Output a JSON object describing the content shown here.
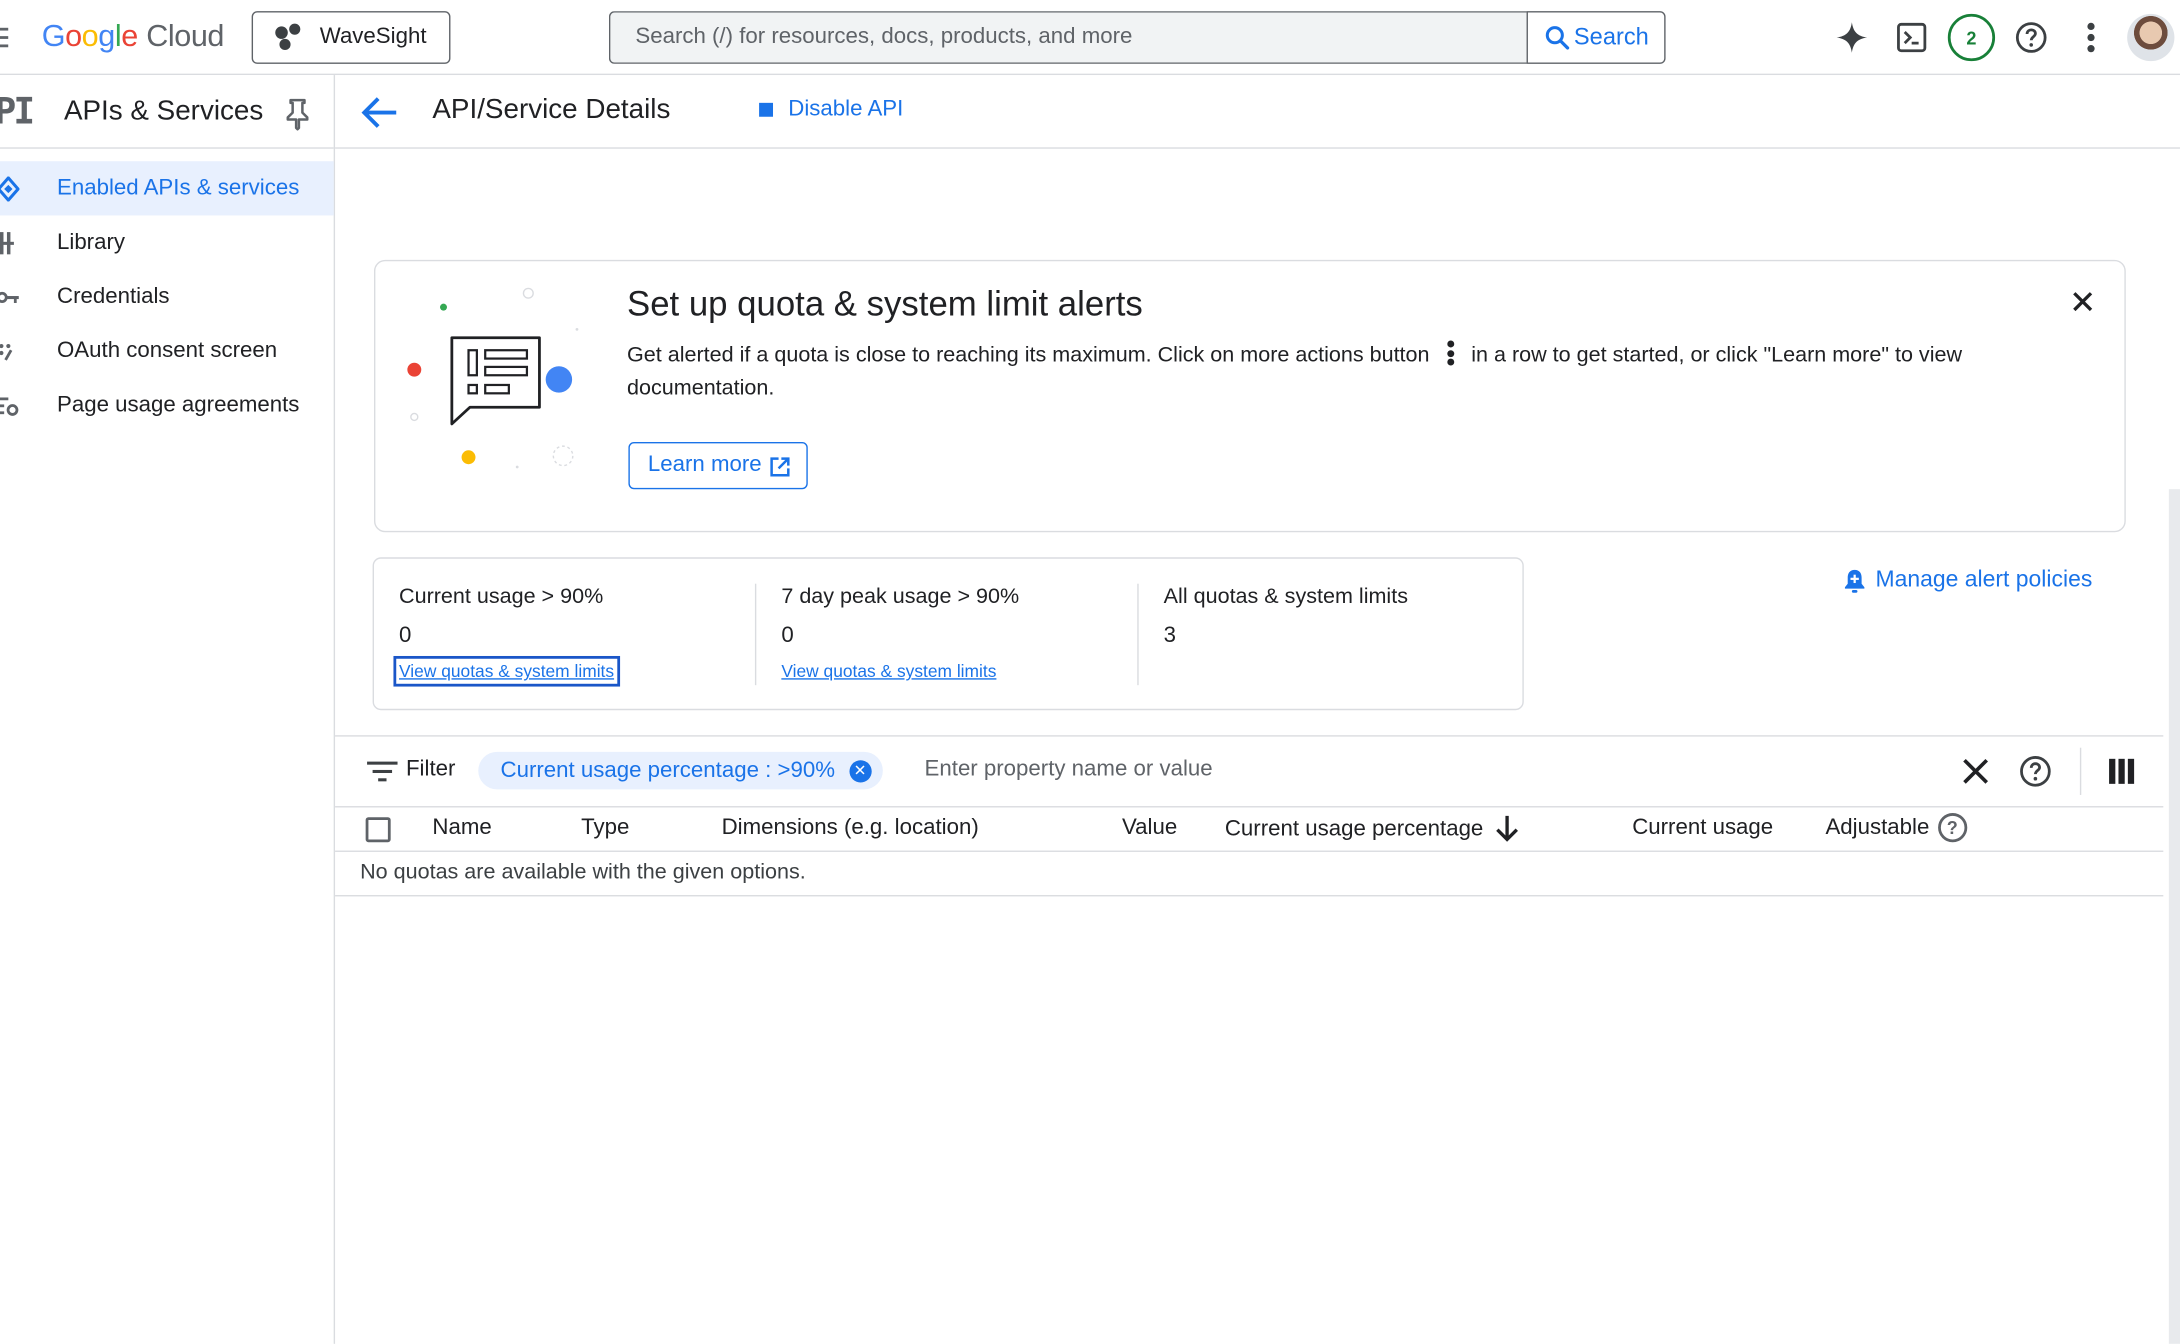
{
  "topbar": {
    "logo_google": "Google",
    "logo_cloud": "Cloud",
    "project_name": "WaveSight",
    "search_placeholder": "Search (/) for resources, docs, products, and more",
    "search_button": "Search",
    "notification_count": "2"
  },
  "sidebar": {
    "product_mark": "PI",
    "title": "APIs & Services",
    "items": [
      {
        "label": "Enabled APIs & services",
        "icon": "diamond-icon",
        "active": true
      },
      {
        "label": "Library",
        "icon": "library-icon",
        "active": false
      },
      {
        "label": "Credentials",
        "icon": "key-icon",
        "active": false
      },
      {
        "label": "OAuth consent screen",
        "icon": "consent-icon",
        "active": false
      },
      {
        "label": "Page usage agreements",
        "icon": "settings-list-icon",
        "active": false
      }
    ]
  },
  "header": {
    "title": "API/Service Details",
    "disable_label": "Disable API"
  },
  "banner": {
    "title": "Set up quota & system limit alerts",
    "text_before": "Get alerted if a quota is close to reaching its maximum. Click on more actions button",
    "text_after": "in a row to get started, or click \"Learn more\" to view documentation.",
    "learn_more": "Learn more"
  },
  "stats": [
    {
      "label": "Current usage > 90%",
      "value": "0",
      "link": "View quotas & system limits"
    },
    {
      "label": "7 day peak usage > 90%",
      "value": "0",
      "link": "View quotas & system limits"
    },
    {
      "label": "All quotas & system limits",
      "value": "3",
      "link": ""
    }
  ],
  "manage_alerts": "Manage alert policies",
  "filter": {
    "label": "Filter",
    "chip_text": "Current usage percentage : >90%",
    "input_placeholder": "Enter property name or value"
  },
  "table": {
    "columns": [
      "Name",
      "Type",
      "Dimensions (e.g. location)",
      "Value",
      "Current usage percentage",
      "Current usage",
      "Adjustable"
    ],
    "empty_message": "No quotas are available with the given options."
  },
  "colors": {
    "accent": "#1a73e8",
    "active_bg": "#e8f0fe",
    "border": "#dadce0",
    "success": "#188038"
  }
}
